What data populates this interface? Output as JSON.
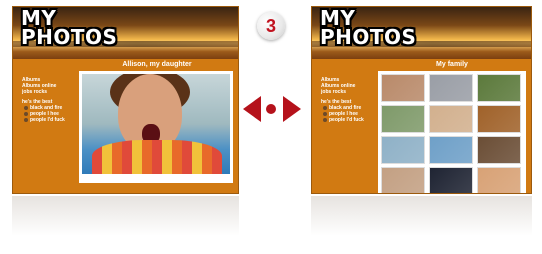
{
  "step": "3",
  "left_panel": {
    "logo": {
      "line1": "MY",
      "line2": "PHOTOS"
    },
    "title": "Allison, my daughter",
    "sidebar": {
      "group1": [
        "Albums",
        "Albums online",
        "jobs rocks"
      ],
      "group2_heading": "he's the best",
      "group2_items": [
        "black and fire",
        "people I hee",
        "people I'd fuck"
      ]
    }
  },
  "right_panel": {
    "logo": {
      "line1": "MY",
      "line2": "PHOTOS"
    },
    "title": "My family",
    "sidebar": {
      "group1": [
        "Albums",
        "Albums online",
        "jobs rocks"
      ],
      "group2_heading": "he's the best",
      "group2_items": [
        "black and fire",
        "people I hee",
        "people I'd fuck"
      ]
    },
    "thumbnails": [
      "#b98a6a",
      "#9a9ea6",
      "#5c7a3c",
      "#7f9a6a",
      "#d2b08e",
      "#a0622a",
      "#8fb1c7",
      "#6fa0c8",
      "#6b4e36",
      "#c3a083",
      "#1f2433",
      "#d8a276"
    ]
  },
  "colors": {
    "panel_bg": "#d17a12",
    "accent_red": "#b5121b"
  }
}
